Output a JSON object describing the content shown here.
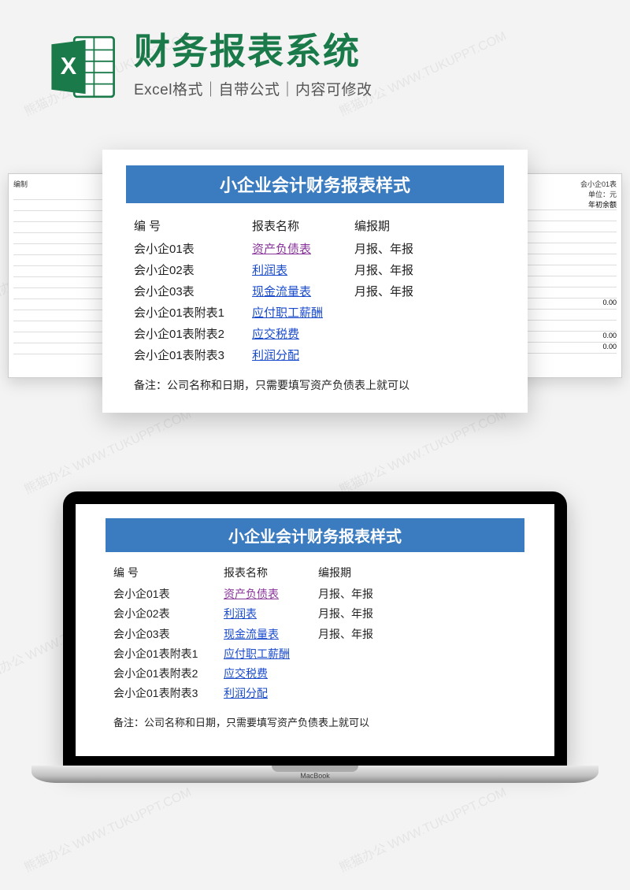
{
  "header": {
    "title": "财务报表系统",
    "subtitle": "Excel格式｜自带公式｜内容可修改",
    "icon_letter": "X"
  },
  "sheet": {
    "banner_title": "小企业会计财务报表样式",
    "columns": {
      "c1": "编  号",
      "c2": "报表名称",
      "c3": "编报期"
    },
    "rows": [
      {
        "code": "会小企01表",
        "name": "资产负债表",
        "period": "月报、年报",
        "visited": true
      },
      {
        "code": "会小企02表",
        "name": "利润表",
        "period": "月报、年报",
        "visited": false
      },
      {
        "code": "会小企03表",
        "name": "现金流量表",
        "period": "月报、年报",
        "visited": false
      },
      {
        "code": "会小企01表附表1",
        "name": "应付职工薪酬",
        "period": "",
        "visited": false
      },
      {
        "code": "会小企01表附表2",
        "name": "应交税费",
        "period": "",
        "visited": false
      },
      {
        "code": "会小企01表附表3",
        "name": "利润分配",
        "period": "",
        "visited": false
      }
    ],
    "note": "备注：公司名称和日期，只需要填写资产负债表上就可以"
  },
  "bg_sheets": {
    "left_header": "编制",
    "right_top": "会小企01表",
    "right_unit": "单位：元",
    "right_col": "年初余额",
    "zero": "0.00"
  },
  "laptop": {
    "brand": "MacBook"
  },
  "watermark": "熊猫办公 WWW.TUKUPPT.COM"
}
